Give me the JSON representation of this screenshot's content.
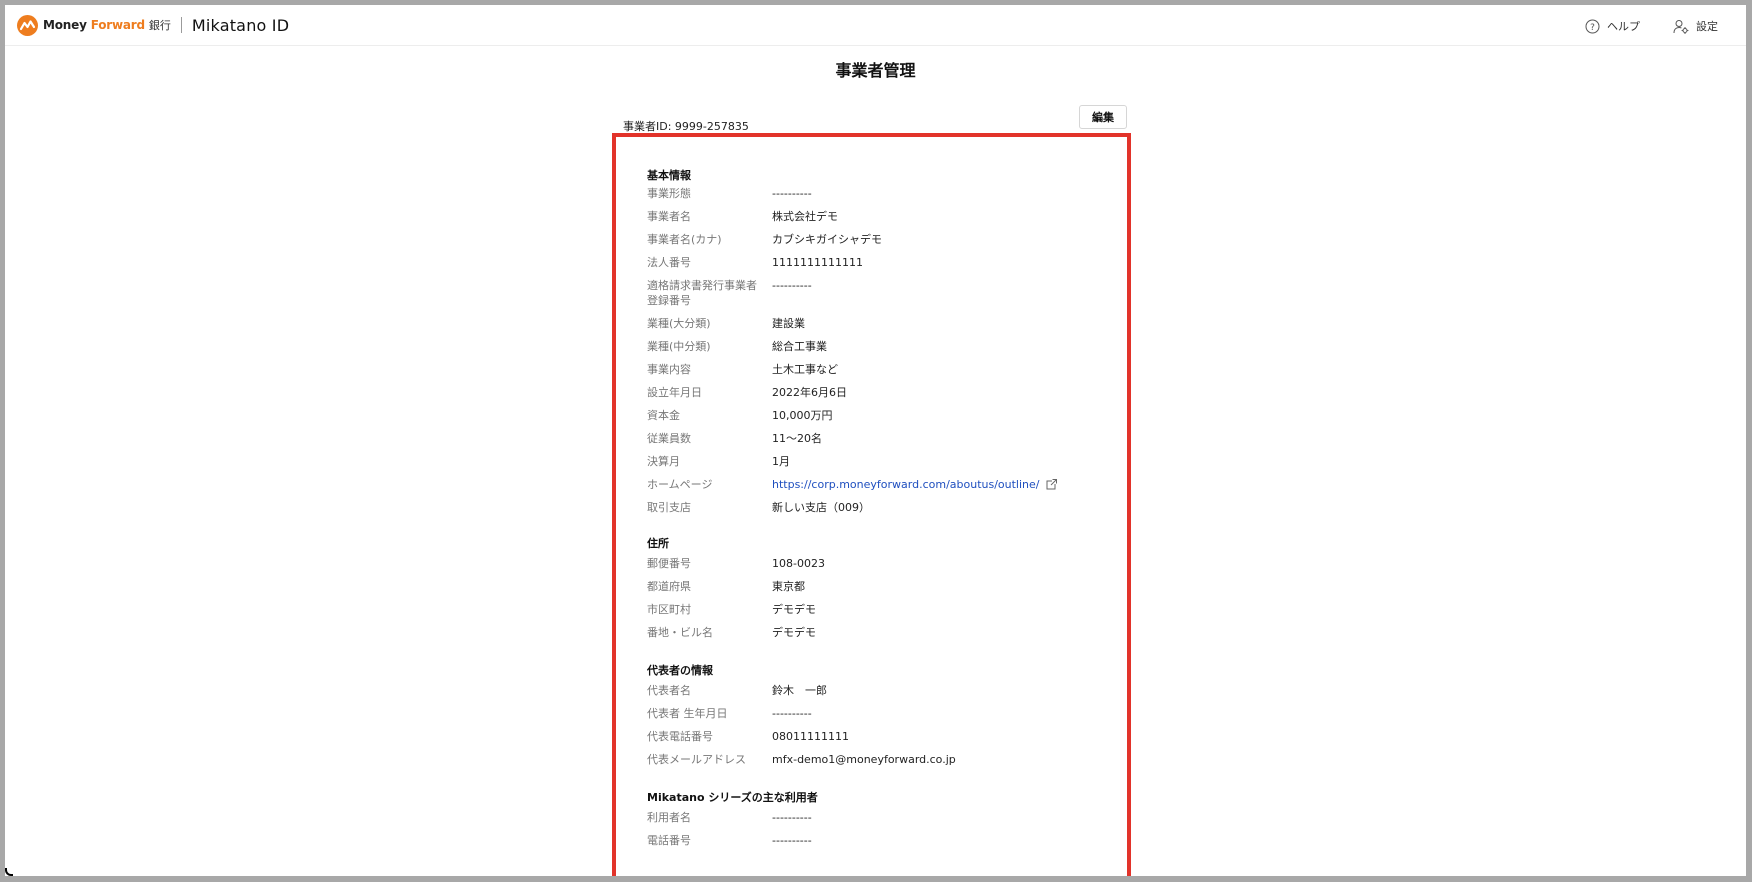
{
  "header": {
    "brand_money": "Money",
    "brand_forward": "Forward",
    "brand_bank": "銀行",
    "brand_mikatano": "Mikatano ID",
    "help_label": "ヘルプ",
    "settings_label": "設定"
  },
  "page": {
    "title": "事業者管理",
    "business_id": "事業者ID: 9999-257835",
    "edit_label": "編集"
  },
  "sections": [
    {
      "title": "基本情報",
      "rows": [
        {
          "label": "事業形態",
          "value": "----------"
        },
        {
          "label": "事業者名",
          "value": "株式会社デモ"
        },
        {
          "label": "事業者名(カナ)",
          "value": "カブシキガイシャデモ"
        },
        {
          "label": "法人番号",
          "value": "1111111111111"
        },
        {
          "label": "適格請求書発行事業者登録番号",
          "value": "----------"
        },
        {
          "label": "業種(大分類)",
          "value": "建設業"
        },
        {
          "label": "業種(中分類)",
          "value": "総合工事業"
        },
        {
          "label": "事業内容",
          "value": "土木工事など"
        },
        {
          "label": "設立年月日",
          "value": "2022年6月6日"
        },
        {
          "label": "資本金",
          "value": "10,000万円"
        },
        {
          "label": "従業員数",
          "value": "11〜20名"
        },
        {
          "label": "決算月",
          "value": "1月"
        },
        {
          "label": "ホームページ",
          "value": "https://corp.moneyforward.com/aboutus/outline/"
        },
        {
          "label": "取引支店",
          "value": "新しい支店（009）"
        }
      ]
    },
    {
      "title": "住所",
      "rows": [
        {
          "label": "郵便番号",
          "value": "108-0023"
        },
        {
          "label": "都道府県",
          "value": "東京都"
        },
        {
          "label": "市区町村",
          "value": "デモデモ"
        },
        {
          "label": "番地・ビル名",
          "value": "デモデモ"
        }
      ]
    },
    {
      "title": "代表者の情報",
      "rows": [
        {
          "label": "代表者名",
          "value": "鈴木　一郎"
        },
        {
          "label": "代表者 生年月日",
          "value": "----------"
        },
        {
          "label": "代表電話番号",
          "value": "08011111111"
        },
        {
          "label": "代表メールアドレス",
          "value": "mfx-demo1@moneyforward.co.jp"
        }
      ]
    },
    {
      "title": "Mikatano シリーズの主な利用者",
      "rows": [
        {
          "label": "利用者名",
          "value": "----------"
        },
        {
          "label": "電話番号",
          "value": "----------"
        }
      ]
    }
  ],
  "colors": {
    "brand_orange": "#ee7d1f",
    "highlight_red": "#e2332a",
    "link_blue": "#1f4fbf"
  }
}
